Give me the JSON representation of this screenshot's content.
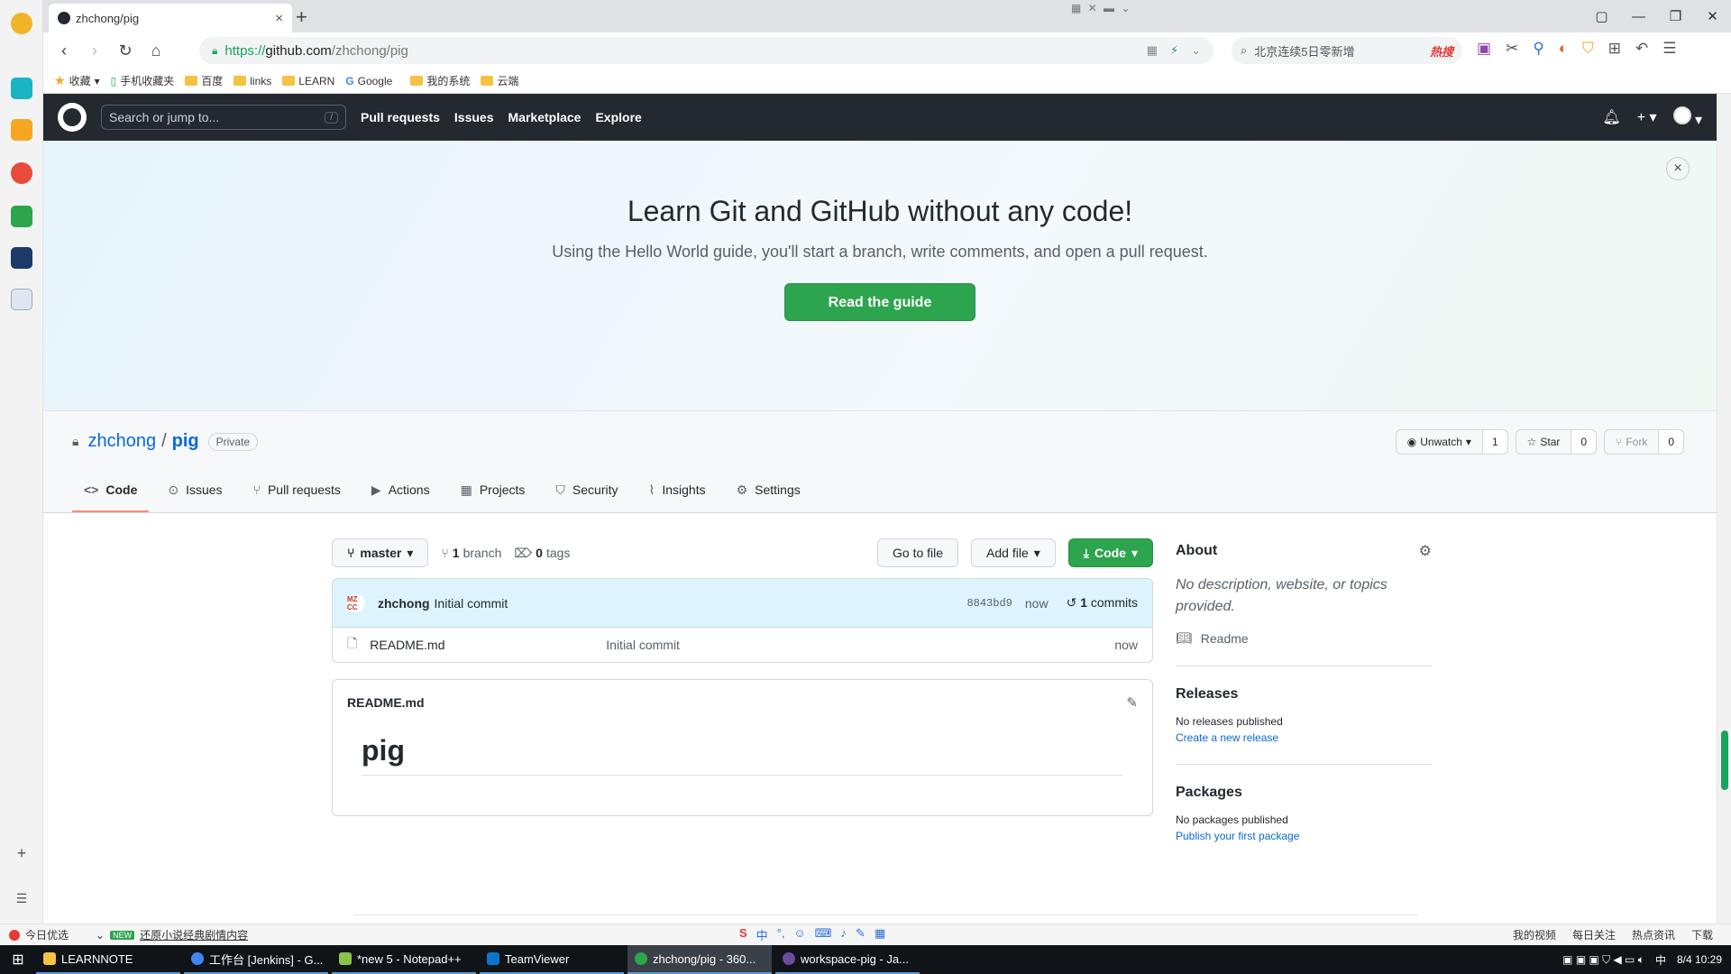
{
  "browser": {
    "tab_title": "zhchong/pig",
    "tab_close": "×",
    "new_tab": "+",
    "url_scheme": "https://",
    "url_host": "github.com",
    "url_path": "/zhchong/pig",
    "search_text": "北京连续5日零新增",
    "search_hot": "热搜",
    "window_controls": [
      "▢",
      "—",
      "❐",
      "✕"
    ],
    "bookmarks": {
      "favorites": "收藏",
      "mobile": "手机收藏夹",
      "items": [
        "百度",
        "links",
        "LEARN",
        "Google",
        "我的系统",
        "云端"
      ]
    }
  },
  "github": {
    "search_placeholder": "Search or jump to...",
    "search_shortcut": "/",
    "nav": [
      "Pull requests",
      "Issues",
      "Marketplace",
      "Explore"
    ],
    "banner": {
      "title": "Learn Git and GitHub without any code!",
      "subtitle": "Using the Hello World guide, you'll start a branch, write comments, and open a pull request.",
      "button": "Read the guide",
      "close": "×"
    },
    "repo": {
      "owner": "zhchong",
      "separator": "/",
      "name": "pig",
      "visibility": "Private",
      "watch_label": "Unwatch",
      "watch_count": "1",
      "star_label": "Star",
      "star_count": "0",
      "fork_label": "Fork",
      "fork_count": "0"
    },
    "tabs": [
      {
        "label": "Code",
        "icon": "<>"
      },
      {
        "label": "Issues",
        "icon": "⊙"
      },
      {
        "label": "Pull requests",
        "icon": "⑂"
      },
      {
        "label": "Actions",
        "icon": "▶"
      },
      {
        "label": "Projects",
        "icon": "▦"
      },
      {
        "label": "Security",
        "icon": "⛉"
      },
      {
        "label": "Insights",
        "icon": "⌇"
      },
      {
        "label": "Settings",
        "icon": "⚙"
      }
    ],
    "branch": {
      "name": "master",
      "branch_count": "1",
      "branch_word": "branch",
      "tag_count": "0",
      "tag_word": "tags",
      "go_to_file": "Go to file",
      "add_file": "Add file",
      "code": "Code"
    },
    "commit": {
      "avatar_text": "MZ CC",
      "author": "zhchong",
      "message": "Initial commit",
      "sha": "8843bd9",
      "when": "now",
      "commit_count": "1",
      "commit_word": "commits"
    },
    "files": [
      {
        "name": "README.md",
        "message": "Initial commit",
        "time": "now"
      }
    ],
    "readme": {
      "filename": "README.md",
      "heading": "pig"
    },
    "about": {
      "title": "About",
      "description": "No description, website, or topics provided.",
      "readme_link": "Readme"
    },
    "releases": {
      "title": "Releases",
      "text": "No releases published",
      "link": "Create a new release"
    },
    "packages": {
      "title": "Packages",
      "text": "No packages published",
      "link": "Publish your first package"
    }
  },
  "statusbar": {
    "left": "今日优选",
    "news_tag": "NEW",
    "news": "还原小说经典剧情内容",
    "center_icons": [
      "S",
      "中",
      "°,",
      "☺",
      "⌨",
      "♪",
      "✎",
      "▦"
    ],
    "right": [
      "我的视频",
      "每日关注",
      "热点资讯",
      "下载"
    ]
  },
  "taskbar": {
    "tasks": [
      {
        "label": "LEARNNOTE",
        "color": "#f5c242"
      },
      {
        "label": "工作台 [Jenkins] - G...",
        "color": "#4285f4"
      },
      {
        "label": "*new 5 - Notepad++",
        "color": "#8bc34a"
      },
      {
        "label": "TeamViewer",
        "color": "#0e73cc"
      },
      {
        "label": "zhchong/pig - 360...",
        "color": "#2da44e"
      },
      {
        "label": "workspace-pig - Ja...",
        "color": "#6a4c9c"
      }
    ],
    "tray_lang": "中",
    "clock": "8/4 10:29"
  },
  "colors": {
    "gh_header": "#24292f",
    "primary_green": "#2da44e",
    "link_blue": "#0969da",
    "tab_underline": "#fd8c73"
  }
}
